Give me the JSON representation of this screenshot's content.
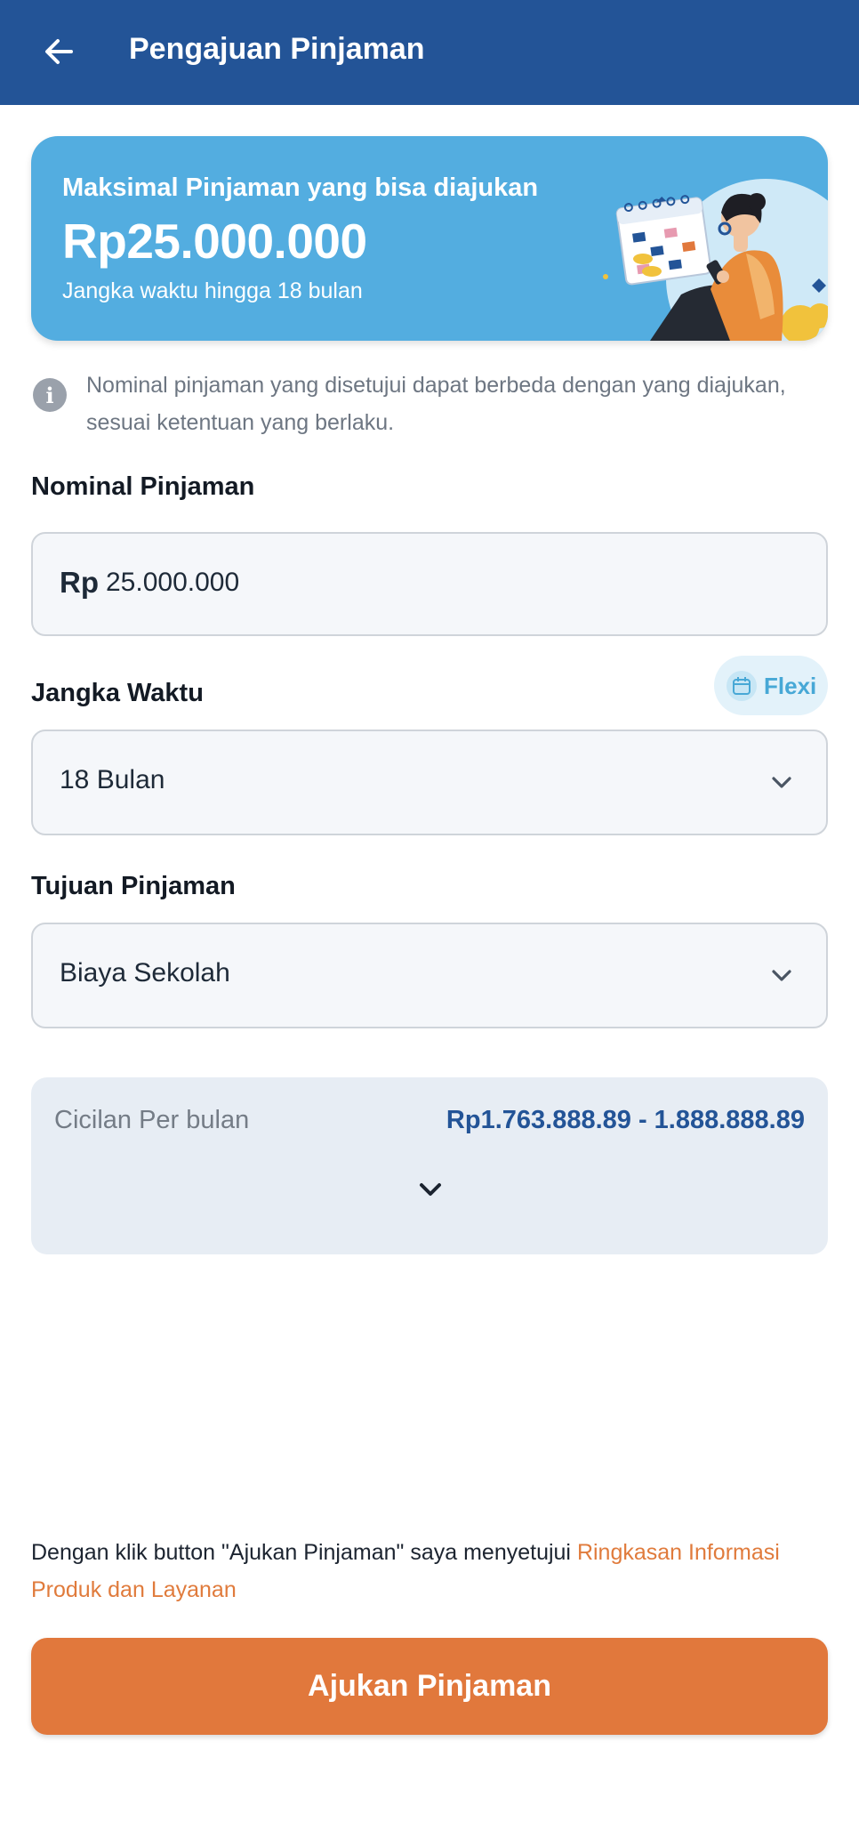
{
  "header": {
    "title": "Pengajuan Pinjaman",
    "back_icon": "arrow-left-icon"
  },
  "banner": {
    "label": "Maksimal Pinjaman yang bisa diajukan",
    "amount": "Rp25.000.000",
    "tenor": "Jangka waktu hingga 18 bulan"
  },
  "info": {
    "icon": "info-icon",
    "text": "Nominal pinjaman yang disetujui dapat berbeda dengan yang diajukan, sesuai ketentuan yang berlaku."
  },
  "loan_amount": {
    "label": "Nominal Pinjaman",
    "prefix": "Rp",
    "value": "25.000.000"
  },
  "tenor": {
    "label": "Jangka Waktu",
    "badge": "Flexi",
    "selected": "18 Bulan"
  },
  "purpose": {
    "label": "Tujuan Pinjaman",
    "selected": "Biaya Sekolah"
  },
  "installment": {
    "label": "Cicilan Per bulan",
    "value": "Rp1.763.888.89 - 1.888.888.89"
  },
  "disclaimer": {
    "text": "Dengan klik button \"Ajukan Pinjaman\" saya menyetujui ",
    "link": "Ringkasan Informasi Produk dan Layanan"
  },
  "submit": {
    "label": "Ajukan Pinjaman"
  },
  "colors": {
    "primary": "#235497",
    "banner": "#53ade0",
    "accent": "#e1783c",
    "flexi": "#47a8d6"
  }
}
